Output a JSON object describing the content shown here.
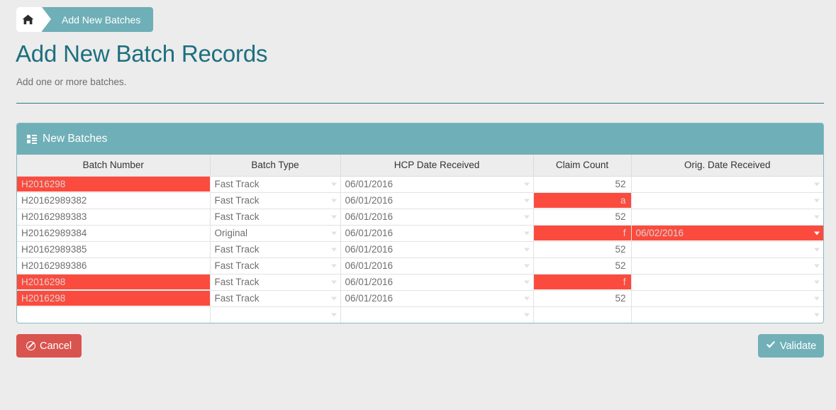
{
  "breadcrumb": {
    "home_icon": "home-icon",
    "current": "Add New Batches"
  },
  "header": {
    "title": "Add New Batch Records",
    "subtitle": "Add one or more batches."
  },
  "panel": {
    "icon": "th-list-icon",
    "title": "New Batches"
  },
  "grid": {
    "columns": [
      "Batch Number",
      "Batch Type",
      "HCP Date Received",
      "Claim Count",
      "Orig. Date Received"
    ],
    "rows": [
      {
        "batch_number": "H2016298",
        "batch_number_invalid": true,
        "batch_type": "Fast Track",
        "batch_type_invalid": false,
        "hcp_date": "06/01/2016",
        "hcp_date_invalid": false,
        "claim_count": "52",
        "claim_count_invalid": false,
        "orig_date": "",
        "orig_date_invalid": false
      },
      {
        "batch_number": "H20162989382",
        "batch_number_invalid": false,
        "batch_type": "Fast Track",
        "batch_type_invalid": false,
        "hcp_date": "06/01/2016",
        "hcp_date_invalid": false,
        "claim_count": "a",
        "claim_count_invalid": true,
        "orig_date": "",
        "orig_date_invalid": false
      },
      {
        "batch_number": "H20162989383",
        "batch_number_invalid": false,
        "batch_type": "Fast Track",
        "batch_type_invalid": false,
        "hcp_date": "06/01/2016",
        "hcp_date_invalid": false,
        "claim_count": "52",
        "claim_count_invalid": false,
        "orig_date": "",
        "orig_date_invalid": false
      },
      {
        "batch_number": "H20162989384",
        "batch_number_invalid": false,
        "batch_type": "Original",
        "batch_type_invalid": false,
        "hcp_date": "06/01/2016",
        "hcp_date_invalid": false,
        "claim_count": "f",
        "claim_count_invalid": true,
        "orig_date": "06/02/2016",
        "orig_date_invalid": true
      },
      {
        "batch_number": "H20162989385",
        "batch_number_invalid": false,
        "batch_type": "Fast Track",
        "batch_type_invalid": false,
        "hcp_date": "06/01/2016",
        "hcp_date_invalid": false,
        "claim_count": "52",
        "claim_count_invalid": false,
        "orig_date": "",
        "orig_date_invalid": false
      },
      {
        "batch_number": "H20162989386",
        "batch_number_invalid": false,
        "batch_type": "Fast Track",
        "batch_type_invalid": false,
        "hcp_date": "06/01/2016",
        "hcp_date_invalid": false,
        "claim_count": "52",
        "claim_count_invalid": false,
        "orig_date": "",
        "orig_date_invalid": false
      },
      {
        "batch_number": "H2016298",
        "batch_number_invalid": true,
        "batch_type": "Fast Track",
        "batch_type_invalid": false,
        "hcp_date": "06/01/2016",
        "hcp_date_invalid": false,
        "claim_count": "f",
        "claim_count_invalid": true,
        "orig_date": "",
        "orig_date_invalid": false
      },
      {
        "batch_number": "H2016298",
        "batch_number_invalid": true,
        "batch_type": "Fast Track",
        "batch_type_invalid": false,
        "hcp_date": "06/01/2016",
        "hcp_date_invalid": false,
        "claim_count": "52",
        "claim_count_invalid": false,
        "orig_date": "",
        "orig_date_invalid": false
      },
      {
        "batch_number": "",
        "batch_number_invalid": false,
        "batch_type": "",
        "batch_type_invalid": false,
        "hcp_date": "",
        "hcp_date_invalid": false,
        "claim_count": "",
        "claim_count_invalid": false,
        "orig_date": "",
        "orig_date_invalid": false
      }
    ]
  },
  "actions": {
    "cancel_label": "Cancel",
    "cancel_icon": "ban-circle-icon",
    "validate_label": "Validate",
    "validate_icon": "check-icon"
  },
  "colors": {
    "teal": "#6fafb7",
    "teal_dark": "#1d6f7f",
    "invalid_red": "#fb4b3e",
    "cancel_red": "#d9534f",
    "page_bg": "#ececec",
    "header_bg": "#ededed"
  }
}
